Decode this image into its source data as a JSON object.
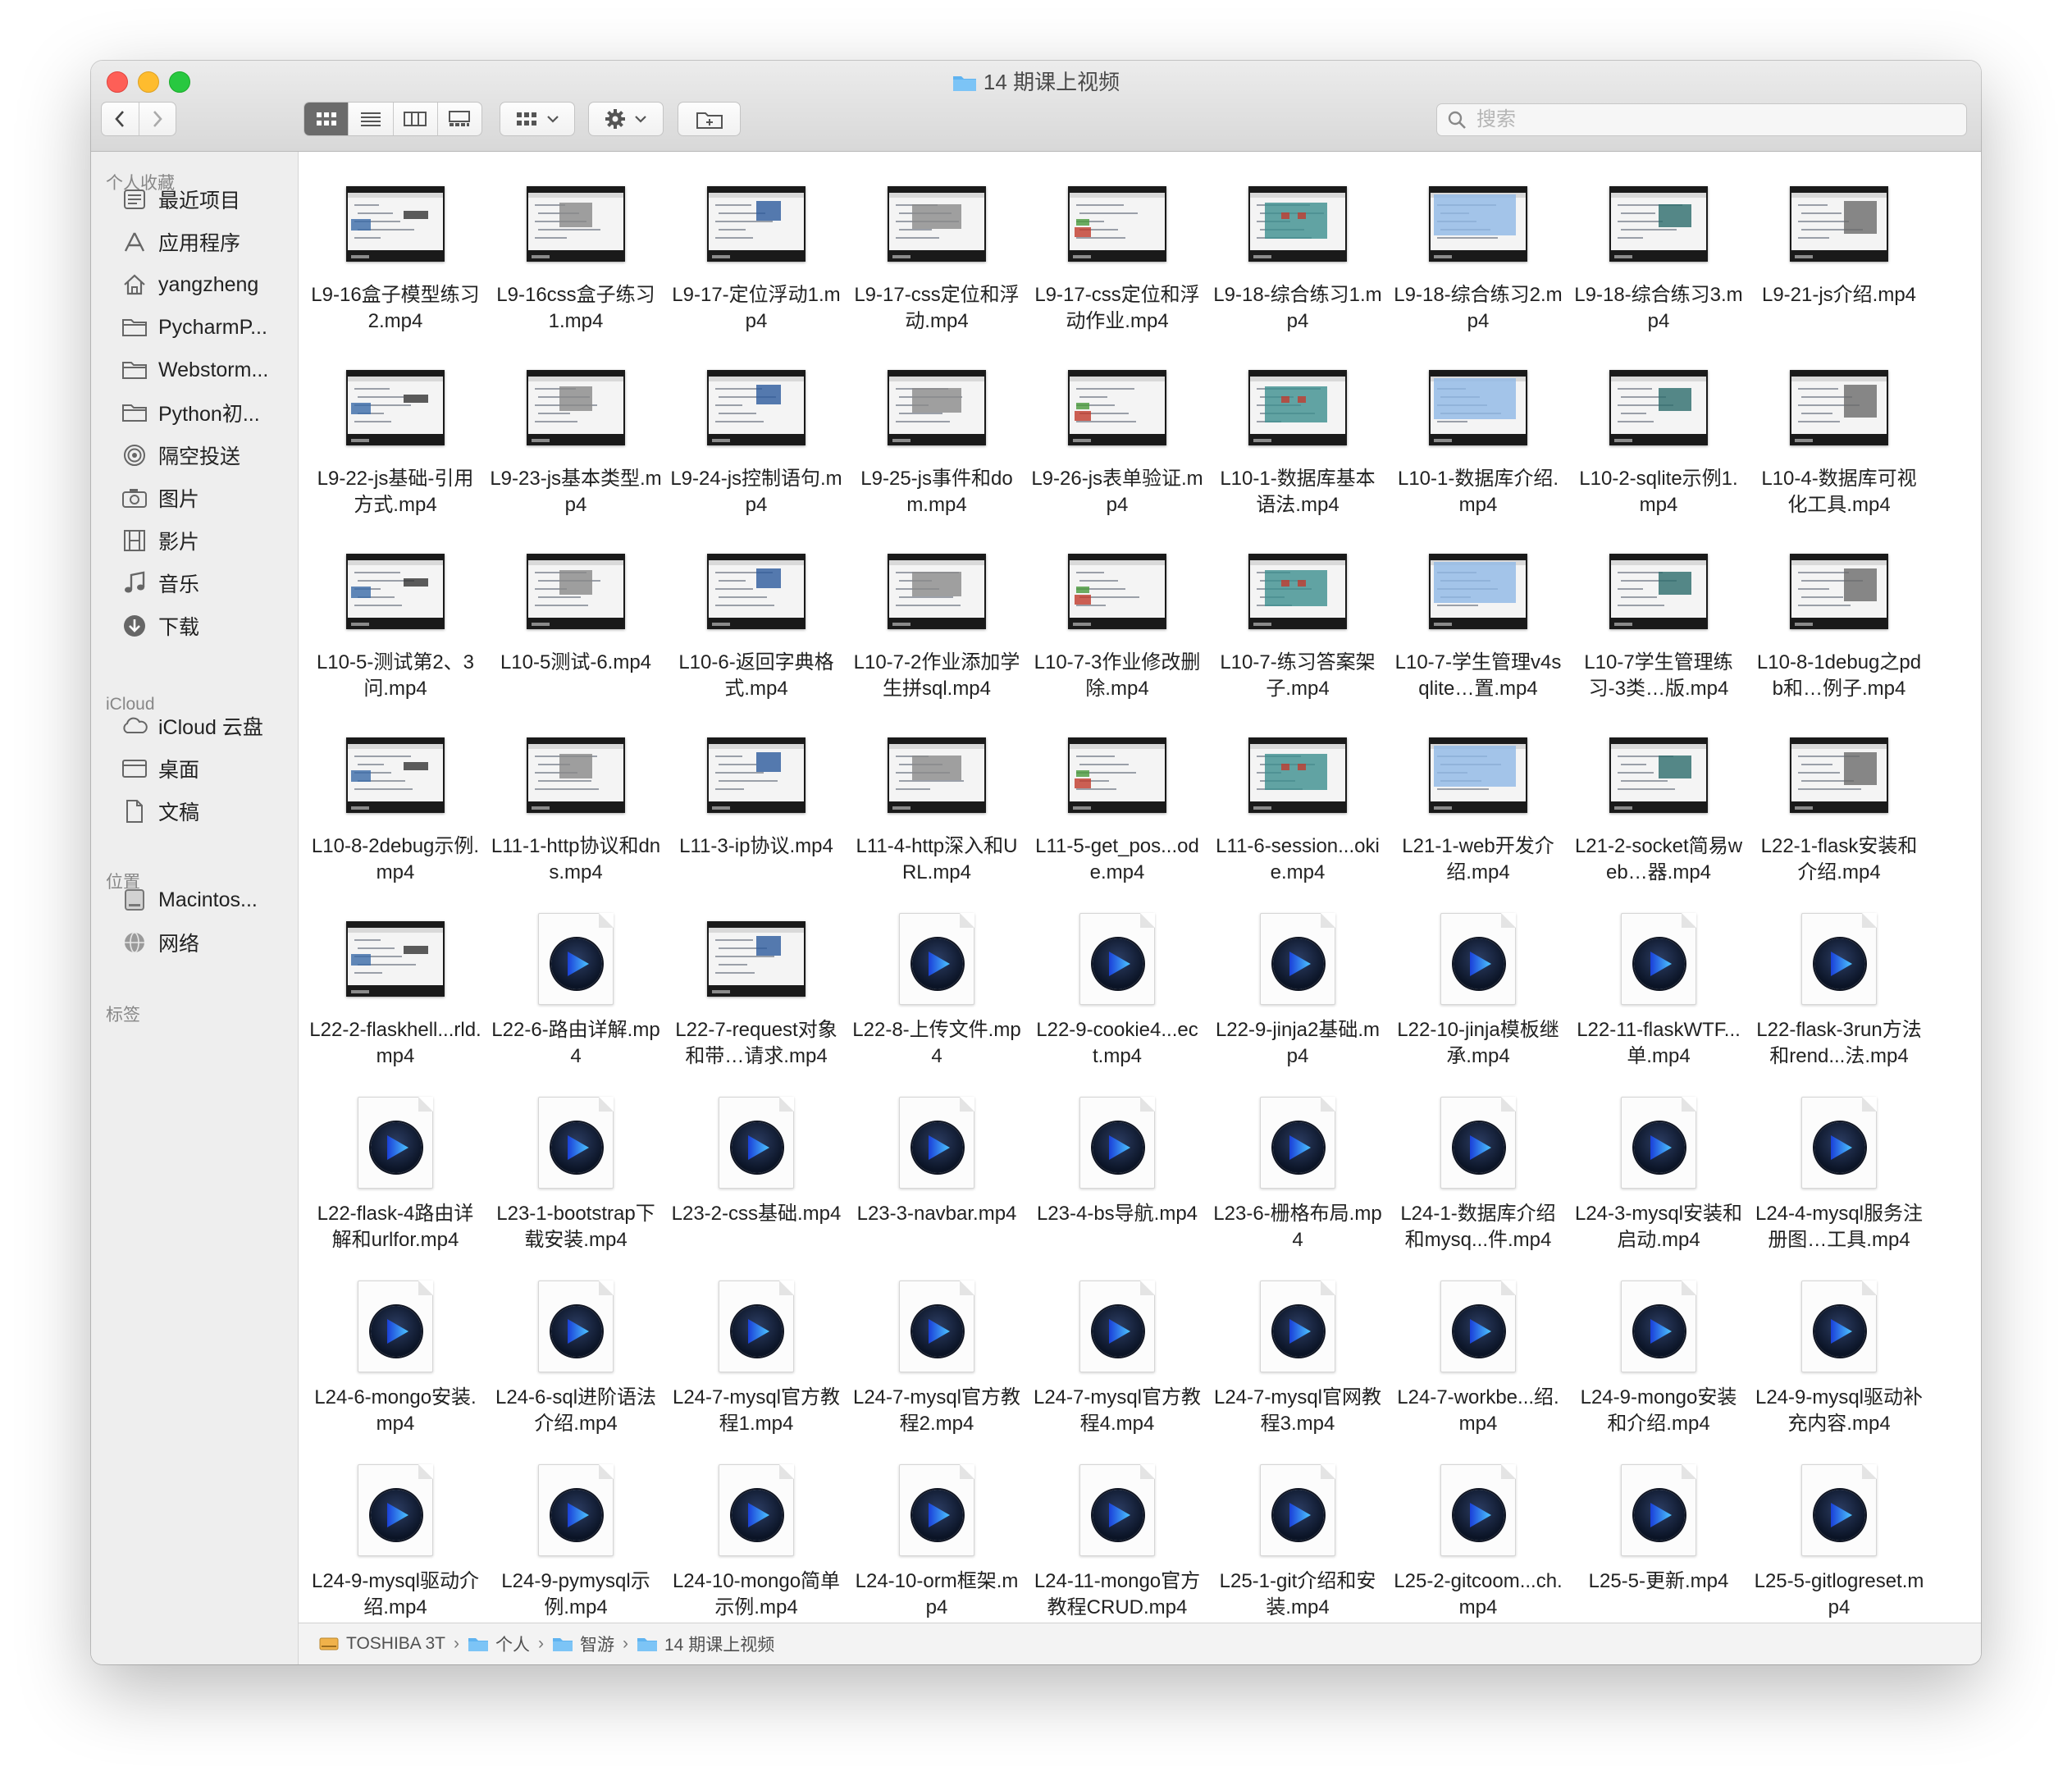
{
  "window": {
    "title": "14 期课上视频",
    "search_placeholder": "搜索"
  },
  "sidebar": {
    "sections": [
      {
        "label": "个人收藏",
        "items": [
          {
            "label": "最近项目",
            "icon": "clock-icon"
          },
          {
            "label": "应用程序",
            "icon": "applications-icon"
          },
          {
            "label": "yangzheng",
            "icon": "home-icon"
          },
          {
            "label": "PycharmP...",
            "icon": "folder-icon"
          },
          {
            "label": "Webstorm...",
            "icon": "folder-icon"
          },
          {
            "label": "Python初...",
            "icon": "folder-icon"
          },
          {
            "label": "隔空投送",
            "icon": "airdrop-icon"
          },
          {
            "label": "图片",
            "icon": "camera-icon"
          },
          {
            "label": "影片",
            "icon": "film-icon"
          },
          {
            "label": "音乐",
            "icon": "music-note-icon"
          },
          {
            "label": "下载",
            "icon": "download-icon"
          }
        ]
      },
      {
        "label": "iCloud",
        "items": [
          {
            "label": "iCloud 云盘",
            "icon": "cloud-icon"
          },
          {
            "label": "桌面",
            "icon": "desktop-icon"
          },
          {
            "label": "文稿",
            "icon": "document-icon"
          }
        ]
      },
      {
        "label": "位置",
        "items": [
          {
            "label": "Macintos...",
            "icon": "hard-drive-icon"
          },
          {
            "label": "网络",
            "icon": "globe-icon"
          }
        ]
      },
      {
        "label": "标签",
        "items": []
      }
    ]
  },
  "files": [
    {
      "name": "L9-16盒子模型练习2.mp4",
      "kind": "thumb"
    },
    {
      "name": "L9-16css盒子练习1.mp4",
      "kind": "thumb"
    },
    {
      "name": "L9-17-定位浮动1.mp4",
      "kind": "thumb"
    },
    {
      "name": "L9-17-css定位和浮动.mp4",
      "kind": "thumb"
    },
    {
      "name": "L9-17-css定位和浮动作业.mp4",
      "kind": "thumb"
    },
    {
      "name": "L9-18-综合练习1.mp4",
      "kind": "thumb"
    },
    {
      "name": "L9-18-综合练习2.mp4",
      "kind": "thumb"
    },
    {
      "name": "L9-18-综合练习3.mp4",
      "kind": "thumb"
    },
    {
      "name": "L9-21-js介绍.mp4",
      "kind": "thumb"
    },
    {
      "name": "L9-22-js基础-引用方式.mp4",
      "kind": "thumb"
    },
    {
      "name": "L9-23-js基本类型.mp4",
      "kind": "thumb"
    },
    {
      "name": "L9-24-js控制语句.mp4",
      "kind": "thumb"
    },
    {
      "name": "L9-25-js事件和dom.mp4",
      "kind": "thumb"
    },
    {
      "name": "L9-26-js表单验证.mp4",
      "kind": "thumb"
    },
    {
      "name": "L10-1-数据库基本语法.mp4",
      "kind": "thumb"
    },
    {
      "name": "L10-1-数据库介绍.mp4",
      "kind": "thumb"
    },
    {
      "name": "L10-2-sqlite示例1.mp4",
      "kind": "thumb"
    },
    {
      "name": "L10-4-数据库可视化工具.mp4",
      "kind": "thumb"
    },
    {
      "name": "L10-5-测试第2、3问.mp4",
      "kind": "thumb"
    },
    {
      "name": "L10-5测试-6.mp4",
      "kind": "thumb"
    },
    {
      "name": "L10-6-返回字典格式.mp4",
      "kind": "thumb"
    },
    {
      "name": "L10-7-2作业添加学生拼sql.mp4",
      "kind": "thumb"
    },
    {
      "name": "L10-7-3作业修改删除.mp4",
      "kind": "thumb"
    },
    {
      "name": "L10-7-练习答案架子.mp4",
      "kind": "thumb"
    },
    {
      "name": "L10-7-学生管理v4sqlite…置.mp4",
      "kind": "thumb"
    },
    {
      "name": "L10-7学生管理练习-3类…版.mp4",
      "kind": "thumb"
    },
    {
      "name": "L10-8-1debug之pdb和…例子.mp4",
      "kind": "thumb"
    },
    {
      "name": "L10-8-2debug示例.mp4",
      "kind": "thumb"
    },
    {
      "name": "L11-1-http协议和dns.mp4",
      "kind": "thumb"
    },
    {
      "name": "L11-3-ip协议.mp4",
      "kind": "thumb"
    },
    {
      "name": "L11-4-http深入和URL.mp4",
      "kind": "thumb"
    },
    {
      "name": "L11-5-get_pos...ode.mp4",
      "kind": "thumb"
    },
    {
      "name": "L11-6-session...okie.mp4",
      "kind": "thumb"
    },
    {
      "name": "L21-1-web开发介绍.mp4",
      "kind": "thumb"
    },
    {
      "name": "L21-2-socket简易web…器.mp4",
      "kind": "thumb"
    },
    {
      "name": "L22-1-flask安装和介绍.mp4",
      "kind": "thumb"
    },
    {
      "name": "L22-2-flaskhell...rld.mp4",
      "kind": "thumb"
    },
    {
      "name": "L22-6-路由详解.mp4",
      "kind": "video"
    },
    {
      "name": "L22-7-request对象和带…请求.mp4",
      "kind": "thumb"
    },
    {
      "name": "L22-8-上传文件.mp4",
      "kind": "video"
    },
    {
      "name": "L22-9-cookie4...ect.mp4",
      "kind": "video"
    },
    {
      "name": "L22-9-jinja2基础.mp4",
      "kind": "video"
    },
    {
      "name": "L22-10-jinja模板继承.mp4",
      "kind": "video"
    },
    {
      "name": "L22-11-flaskWTF...单.mp4",
      "kind": "video"
    },
    {
      "name": "L22-flask-3run方法和rend...法.mp4",
      "kind": "video"
    },
    {
      "name": "L22-flask-4路由详解和urlfor.mp4",
      "kind": "video"
    },
    {
      "name": "L23-1-bootstrap下载安装.mp4",
      "kind": "video"
    },
    {
      "name": "L23-2-css基础.mp4",
      "kind": "video"
    },
    {
      "name": "L23-3-navbar.mp4",
      "kind": "video"
    },
    {
      "name": "L23-4-bs导航.mp4",
      "kind": "video"
    },
    {
      "name": "L23-6-栅格布局.mp4",
      "kind": "video"
    },
    {
      "name": "L24-1-数据库介绍和mysq...件.mp4",
      "kind": "video"
    },
    {
      "name": "L24-3-mysql安装和启动.mp4",
      "kind": "video"
    },
    {
      "name": "L24-4-mysql服务注册图…工具.mp4",
      "kind": "video"
    },
    {
      "name": "L24-6-mongo安装.mp4",
      "kind": "video"
    },
    {
      "name": "L24-6-sql进阶语法介绍.mp4",
      "kind": "video"
    },
    {
      "name": "L24-7-mysql官方教程1.mp4",
      "kind": "video"
    },
    {
      "name": "L24-7-mysql官方教程2.mp4",
      "kind": "video"
    },
    {
      "name": "L24-7-mysql官方教程4.mp4",
      "kind": "video"
    },
    {
      "name": "L24-7-mysql官网教程3.mp4",
      "kind": "video"
    },
    {
      "name": "L24-7-workbe...绍.mp4",
      "kind": "video"
    },
    {
      "name": "L24-9-mongo安装和介绍.mp4",
      "kind": "video"
    },
    {
      "name": "L24-9-mysql驱动补充内容.mp4",
      "kind": "video"
    },
    {
      "name": "L24-9-mysql驱动介绍.mp4",
      "kind": "video"
    },
    {
      "name": "L24-9-pymysql示例.mp4",
      "kind": "video"
    },
    {
      "name": "L24-10-mongo简单示例.mp4",
      "kind": "video"
    },
    {
      "name": "L24-10-orm框架.mp4",
      "kind": "video"
    },
    {
      "name": "L24-11-mongo官方教程CRUD.mp4",
      "kind": "video"
    },
    {
      "name": "L25-1-git介绍和安装.mp4",
      "kind": "video"
    },
    {
      "name": "L25-2-gitcoom...ch.mp4",
      "kind": "video"
    },
    {
      "name": "L25-5-更新.mp4",
      "kind": "video"
    },
    {
      "name": "L25-5-gitlogreset.mp4",
      "kind": "video"
    }
  ],
  "pathbar": [
    {
      "label": "TOSHIBA 3T",
      "icon": "external-drive-icon"
    },
    {
      "label": "个人",
      "icon": "folder-icon"
    },
    {
      "label": "智游",
      "icon": "folder-icon"
    },
    {
      "label": "14 期课上视频",
      "icon": "folder-icon"
    }
  ],
  "colors": {
    "accent": "#2c9bf0",
    "folder": "#5fb3f0",
    "active_segment": "#6b6b6b"
  }
}
